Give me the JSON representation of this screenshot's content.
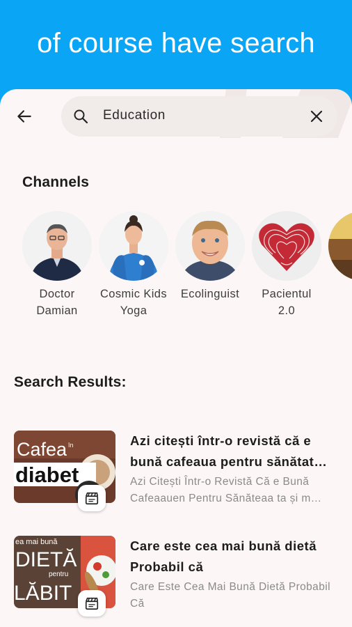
{
  "banner": {
    "text": "of course have search"
  },
  "search": {
    "query": "Education"
  },
  "channels": {
    "title": "Channels",
    "items": [
      {
        "name": "Doctor Damian"
      },
      {
        "name": "Cosmic Kids Yoga"
      },
      {
        "name": "Ecolinguist"
      },
      {
        "name": "Pacientul 2.0"
      }
    ]
  },
  "results": {
    "title": "Search Results:",
    "items": [
      {
        "title": "Azi citești într-o revistă că e bună cafeaua pentru sănătat…",
        "description": "Azi Citești Într-o Revistă Că e Bună Cafeaauen Pentru Sănăteaa ta și m…",
        "thumb_text": [
          "Cafea",
          "în",
          "diabet"
        ]
      },
      {
        "title": "Care este cea mai bună dietă Probabil că",
        "description": "Care Este Cea Mai Bună Dietă Probabil Că",
        "thumb_text": [
          "ea mai bună",
          "DIETĂ",
          "pentru",
          "LĂBIT"
        ]
      }
    ]
  },
  "colors": {
    "banner_bg": "#0aa5f5",
    "page_bg": "#fcf7f6",
    "search_bg": "#f1ebea",
    "title_text": "#1c1c1c",
    "muted_text": "#8a8a8a"
  },
  "icons": {
    "back": "arrow-left-icon",
    "search": "search-icon",
    "clear": "close-icon",
    "video": "video-clapper-icon"
  }
}
